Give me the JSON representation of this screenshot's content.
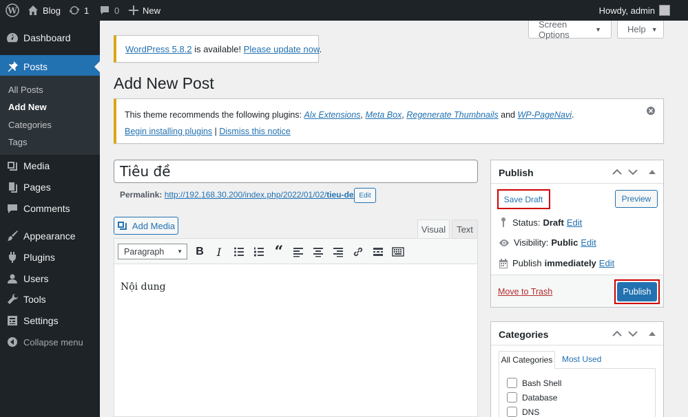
{
  "admin_bar": {
    "site_name": "Blog",
    "updates_count": "1",
    "comments_count": "0",
    "new_label": "New",
    "howdy": "Howdy, admin"
  },
  "sidebar": {
    "dashboard": "Dashboard",
    "posts": "Posts",
    "submenu": [
      "All Posts",
      "Add New",
      "Categories",
      "Tags"
    ],
    "media": "Media",
    "pages": "Pages",
    "comments": "Comments",
    "appearance": "Appearance",
    "plugins": "Plugins",
    "users": "Users",
    "tools": "Tools",
    "settings": "Settings",
    "collapse": "Collapse menu"
  },
  "screen_options": "Screen Options",
  "help": "Help",
  "update_notice": {
    "link1": "WordPress 5.8.2",
    "text": " is available! ",
    "link2": "Please update now",
    "end": "."
  },
  "page_title": "Add New Post",
  "plugin_notice": {
    "text": "This theme recommends the following plugins: ",
    "plugins": [
      "Alx Extensions",
      "Meta Box",
      "Regenerate Thumbnails",
      "WP-PageNavi"
    ],
    "and": " and ",
    "begin": "Begin installing plugins",
    "separator": " | ",
    "dismiss": "Dismiss this notice"
  },
  "post": {
    "title": "Tiêu đề",
    "permalink_label": "Permalink:",
    "permalink_base": "http://192.168.30.200/index.php/2022/01/02/",
    "permalink_slug": "tieu-de",
    "permalink_end": "/",
    "edit_label": "Edit",
    "content": "Nội dung"
  },
  "editor": {
    "add_media": "Add Media",
    "tab_visual": "Visual",
    "tab_text": "Text",
    "format": "Paragraph"
  },
  "publish_box": {
    "title": "Publish",
    "save_draft": "Save Draft",
    "preview": "Preview",
    "status_label": "Status: ",
    "status_value": "Draft",
    "visibility_label": "Visibility: ",
    "visibility_value": "Public",
    "publish_label": "Publish ",
    "publish_value": "immediately",
    "edit": "Edit",
    "move_to_trash": "Move to Trash",
    "publish_button": "Publish"
  },
  "categories_box": {
    "title": "Categories",
    "tab_all": "All Categories",
    "tab_used": "Most Used",
    "items": [
      "Bash Shell",
      "Database",
      "DNS"
    ]
  },
  "colors": {
    "accent": "#2271b1",
    "admin_bar": "#1d2327",
    "highlight_box": "#d00000",
    "notice_border": "#dba617"
  }
}
